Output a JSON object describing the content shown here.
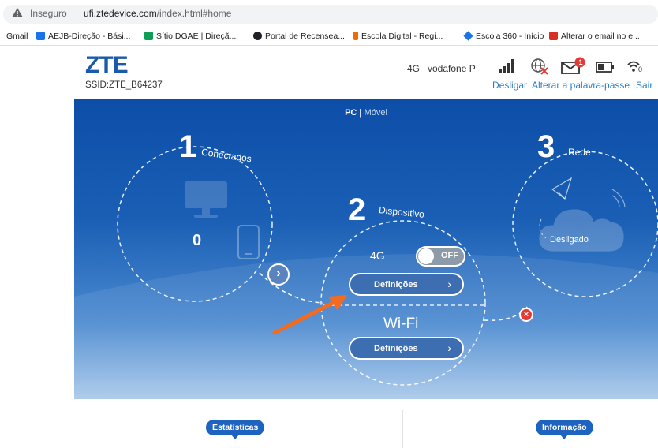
{
  "browser": {
    "insecure_label": "Inseguro",
    "url_host": "ufi.ztedevice.com",
    "url_path": "/index.html#home",
    "bookmarks": [
      {
        "label": "Gmail",
        "icon": "gmail-icon"
      },
      {
        "label": "AEJB-Direção - Bási...",
        "icon": "calendar-icon",
        "color": "#1a73e8"
      },
      {
        "label": "Sítio DGAE | Direçã...",
        "icon": "dgae-icon",
        "color": "#0f9d58"
      },
      {
        "label": "Portal de Recensea...",
        "icon": "globe-icon",
        "color": "#202124"
      },
      {
        "label": "Escola Digital - Regi...",
        "icon": "escola-digital-icon",
        "color": "#ef6c00"
      },
      {
        "label": "Escola 360 - Início",
        "icon": "diamond-icon",
        "color": "#1a73e8"
      },
      {
        "label": "Alterar o email no e...",
        "icon": "gmail-m-icon",
        "color": "#d93025"
      }
    ]
  },
  "header": {
    "logo": "ZTE",
    "ssid": "SSID:ZTE_B64237",
    "network_type": "4G",
    "carrier": "vodafone P",
    "mail_badge": "1",
    "links": {
      "disconnect": "Desligar",
      "change_password": "Alterar a palavra-passe",
      "logout": "Sair"
    },
    "wifi_suffix": "0"
  },
  "panel": {
    "view_pc": "PC",
    "view_sep": "|",
    "view_mobile": "Móvel",
    "step1": {
      "num": "1",
      "label": "Conectados",
      "count": "0"
    },
    "step2": {
      "num": "2",
      "label": "Dispositivo",
      "network": "4G",
      "toggle_state": "OFF",
      "settings_label": "Definições",
      "wifi_label": "Wi-Fi",
      "wifi_settings_label": "Definições"
    },
    "step3": {
      "num": "3",
      "label": "Rede",
      "status": "Desligado"
    },
    "colors": {
      "accent": "#1a5aa8",
      "link": "#2a7fc9",
      "error": "#e53935",
      "arrow": "#f26b21"
    }
  },
  "tabs": {
    "statistics": "Estatísticas",
    "information": "Informação"
  }
}
